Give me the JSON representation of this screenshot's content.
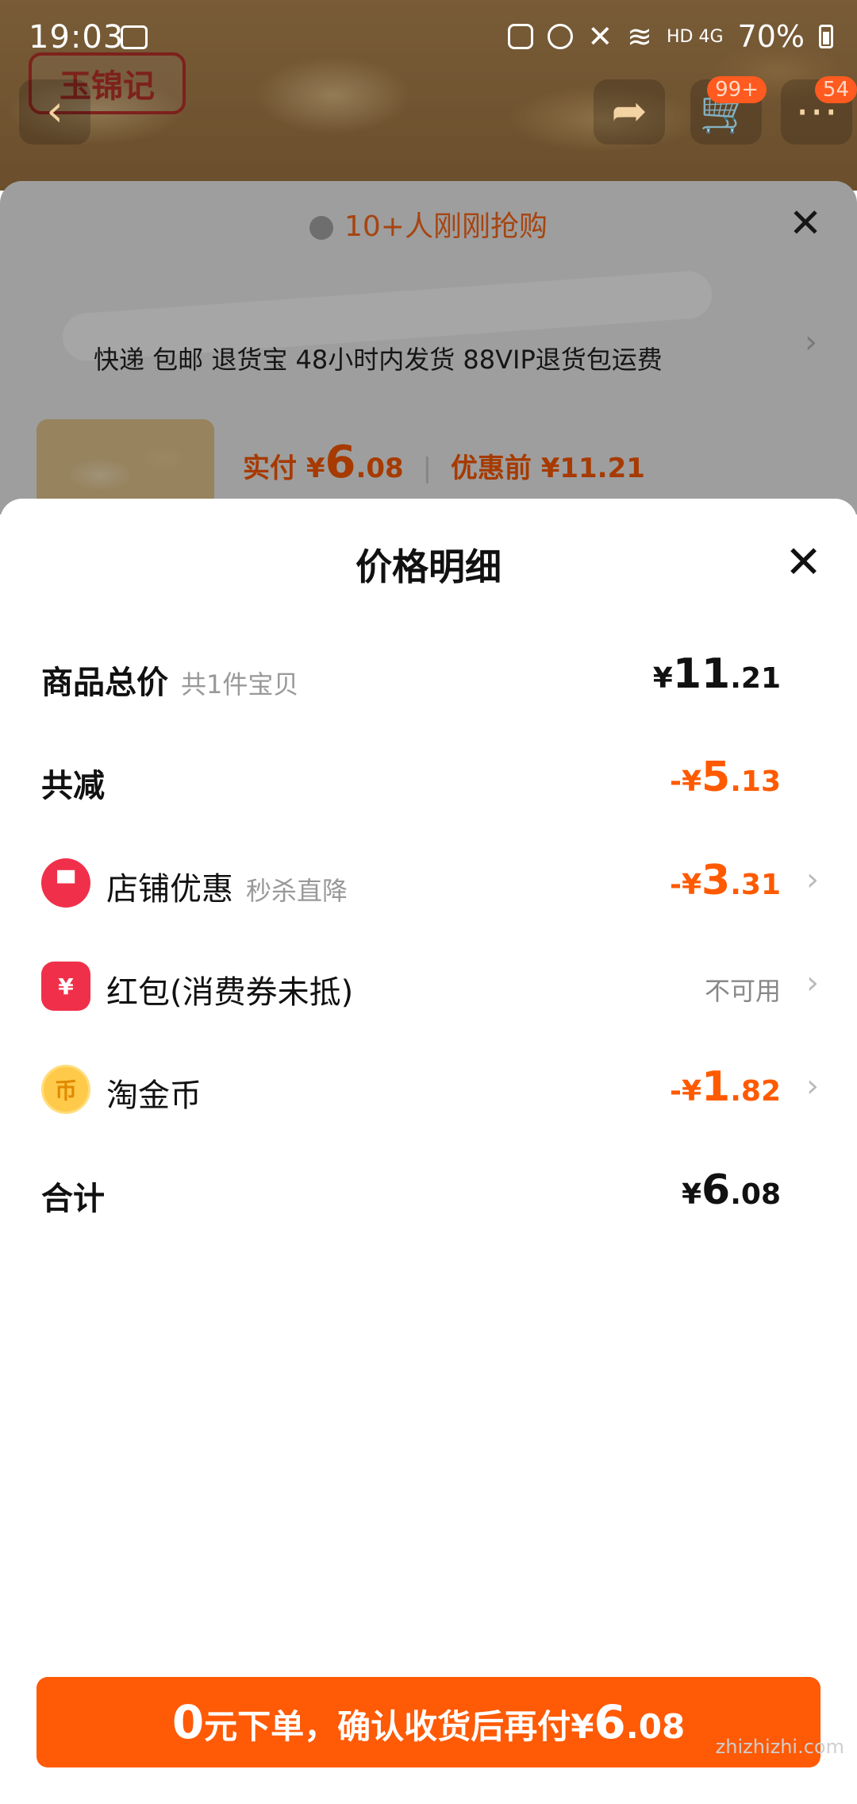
{
  "status_bar": {
    "time": "19:03",
    "network": "HD 4G",
    "battery": "70%"
  },
  "top_nav": {
    "cart_badge": "99+",
    "more_badge": "54",
    "brand_logo": "玉锦记"
  },
  "sheet1": {
    "rush_banner": "10+人刚刚抢购",
    "address_tags": "快递 包邮 退货宝 48小时内发货 88VIP退货包运费",
    "price_prefix": "实付",
    "price_currency": "¥",
    "price_int": "6",
    "price_dec": ".08",
    "before_label": "优惠前 ¥11.21"
  },
  "detail": {
    "title": "价格明细",
    "rows": [
      {
        "label": "商品总价",
        "sub": "共1件宝贝",
        "cur": "¥",
        "int": "11",
        "dec": ".21"
      },
      {
        "label": "共减",
        "cur": "-¥",
        "int": "5",
        "dec": ".13"
      },
      {
        "label": "店铺优惠",
        "sub": "秒杀直降",
        "cur": "-¥",
        "int": "3",
        "dec": ".31"
      },
      {
        "label": "红包(消费券未抵)",
        "value_text": "不可用"
      },
      {
        "label": "淘金币",
        "cur": "-¥",
        "int": "1",
        "dec": ".82"
      },
      {
        "label": "合计",
        "cur": "¥",
        "int": "6",
        "dec": ".08"
      }
    ]
  },
  "cta": {
    "zero": "0",
    "text": "元下单，确认收货后再付",
    "cur": "¥",
    "int": "6",
    "dec": ".08"
  },
  "watermark": "zhizhizhi.com",
  "colors": {
    "accent": "#ff5a06",
    "orange_text": "#ff5a00",
    "red_icon": "#f0304a",
    "coin": "#ffc94a"
  },
  "icons": [
    "image-icon",
    "back-icon",
    "share-icon",
    "cart-icon",
    "more-icon",
    "close-icon",
    "store-icon",
    "red-packet-icon",
    "coin-icon",
    "chevron-right-icon"
  ]
}
